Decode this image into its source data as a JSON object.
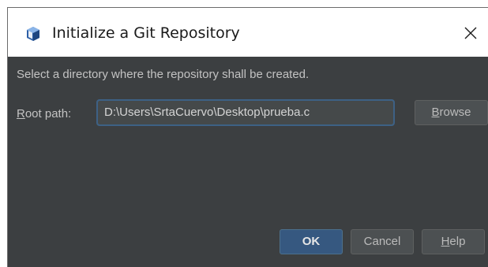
{
  "window": {
    "title": "Initialize a Git Repository",
    "icon": "repository-icon",
    "close_icon": "close-icon"
  },
  "dialog": {
    "instruction": "Select a directory where the repository shall be created.",
    "root_path": {
      "label_mnemonic": "R",
      "label_rest": "oot path:",
      "value": "D:\\Users\\SrtaCuervo\\Desktop\\prueba.c"
    },
    "browse_button": {
      "mnemonic": "B",
      "rest": "rowse"
    }
  },
  "footer": {
    "ok_label": "OK",
    "cancel_label": "Cancel",
    "help_button": {
      "mnemonic": "H",
      "rest": "elp"
    }
  },
  "colors": {
    "background": "#3c3f41",
    "ok_button": "#365880",
    "text": "#bbbbbb"
  }
}
